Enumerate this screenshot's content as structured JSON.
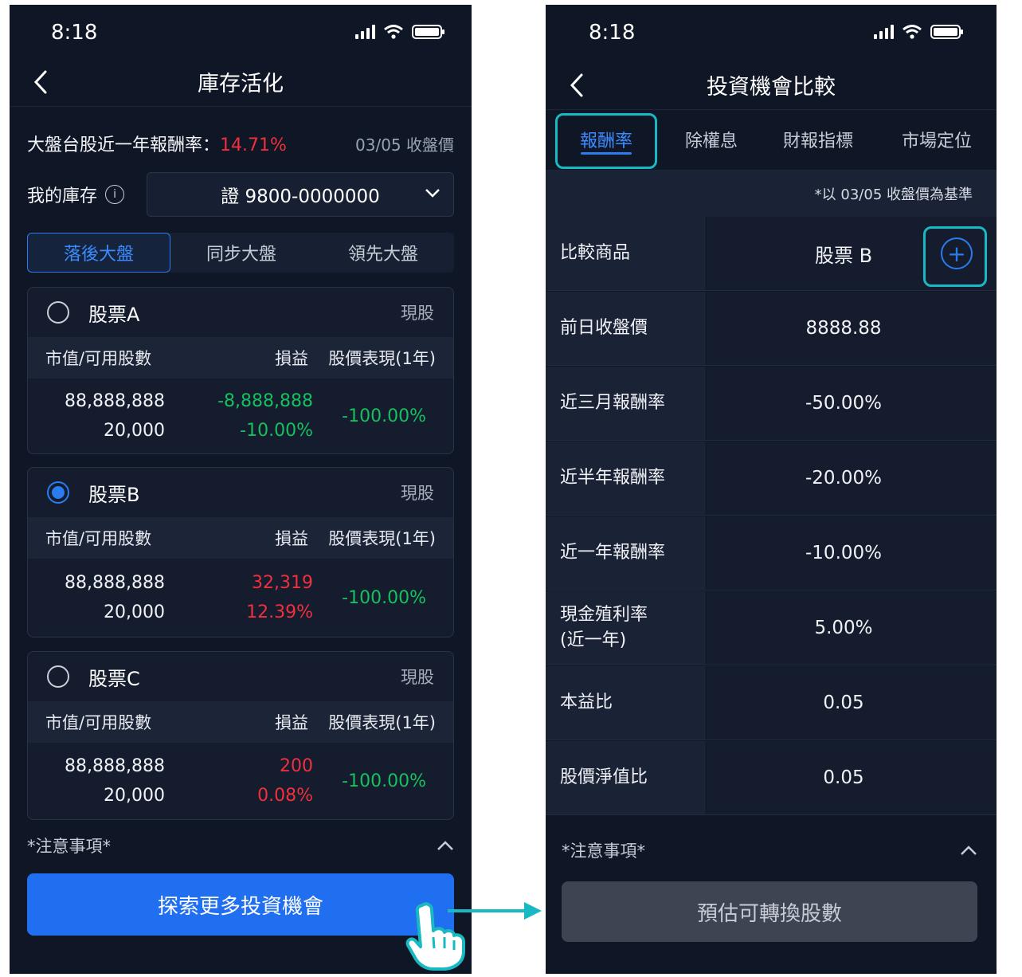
{
  "left": {
    "status_time": "8:18",
    "title": "庫存活化",
    "market_label": "大盤台股近一年報酬率：",
    "market_pct": "14.71%",
    "close_date": "03/05 收盤價",
    "inventory_label": "我的庫存",
    "info_icon_glyph": "i",
    "account": "證 9800-0000000",
    "segments": [
      "落後大盤",
      "同步大盤",
      "領先大盤"
    ],
    "active_segment": 0,
    "col_headers": [
      "市值/可用股數",
      "損益",
      "股價表現(1年)"
    ],
    "cards": [
      {
        "name": "股票A",
        "type": "現股",
        "selected": false,
        "market_value": "88,888,888",
        "shares": "20,000",
        "pl": "-8,888,888",
        "pl_pct": "-10.00%",
        "pl_color": "green",
        "perf": "-100.00%"
      },
      {
        "name": "股票B",
        "type": "現股",
        "selected": true,
        "market_value": "88,888,888",
        "shares": "20,000",
        "pl": "32,319",
        "pl_pct": "12.39%",
        "pl_color": "red",
        "perf": "-100.00%"
      },
      {
        "name": "股票C",
        "type": "現股",
        "selected": false,
        "market_value": "88,888,888",
        "shares": "20,000",
        "pl": "200",
        "pl_pct": "0.08%",
        "pl_color": "red",
        "perf": "-100.00%"
      }
    ],
    "notice": "*注意事項*",
    "explore_button": "探索更多投資機會"
  },
  "right": {
    "status_time": "8:18",
    "title": "投資機會比較",
    "tabs": [
      "報酬率",
      "除權息",
      "財報指標",
      "市場定位"
    ],
    "active_tab": 0,
    "base_note": "*以 03/05 收盤價為基準",
    "compare_label": "比較商品",
    "compare_item": "股票 B",
    "add_glyph": "+",
    "rows": [
      {
        "k": "前日收盤價",
        "v": "8888.88",
        "color": "green"
      },
      {
        "k": "近三月報酬率",
        "v": "-50.00%"
      },
      {
        "k": "近半年報酬率",
        "v": "-20.00%"
      },
      {
        "k": "近一年報酬率",
        "v": "-10.00%"
      },
      {
        "k": "現金殖利率",
        "k2": "(近一年)",
        "v": "5.00%"
      },
      {
        "k": "本益比",
        "v": "0.05"
      },
      {
        "k": "股價淨值比",
        "v": "0.05"
      }
    ],
    "notice": "*注意事項*",
    "estimate_button": "預估可轉換股數"
  },
  "icons": [
    "back-chevron-icon",
    "signal-icon",
    "wifi-icon",
    "battery-icon",
    "info-icon",
    "chevron-down-icon",
    "chevron-up-icon",
    "plus-circle-icon",
    "arrow-right-icon",
    "pointing-hand-icon"
  ],
  "colors": {
    "accent": "#2a7cf0",
    "highlight": "#18b9c2",
    "loss_green": "#17c05e",
    "gain_red": "#f0303c",
    "background": "#0f1626"
  }
}
